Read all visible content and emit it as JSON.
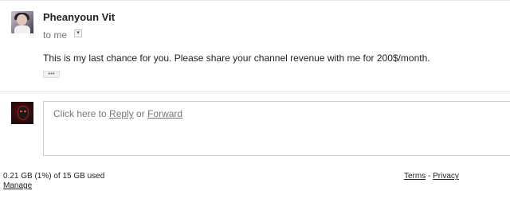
{
  "message": {
    "sender_name": "Pheanyoun Vit",
    "recipient_label": "to me",
    "details_toggle_icon": "chevron-down-icon",
    "details_toggle_glyph": "▾",
    "body": "This is my last chance for you. Please share your channel revenue with me for 200$/month.",
    "trimmed_content_label": "•••"
  },
  "reply": {
    "prefix": "Click here to ",
    "reply_link": "Reply",
    "separator": " or ",
    "forward_link": "Forward"
  },
  "footer": {
    "storage_usage": "0.21 GB (1%) of 15 GB used",
    "manage_link": "Manage",
    "terms_link": "Terms",
    "links_separator": " - ",
    "privacy_link": "Privacy"
  }
}
